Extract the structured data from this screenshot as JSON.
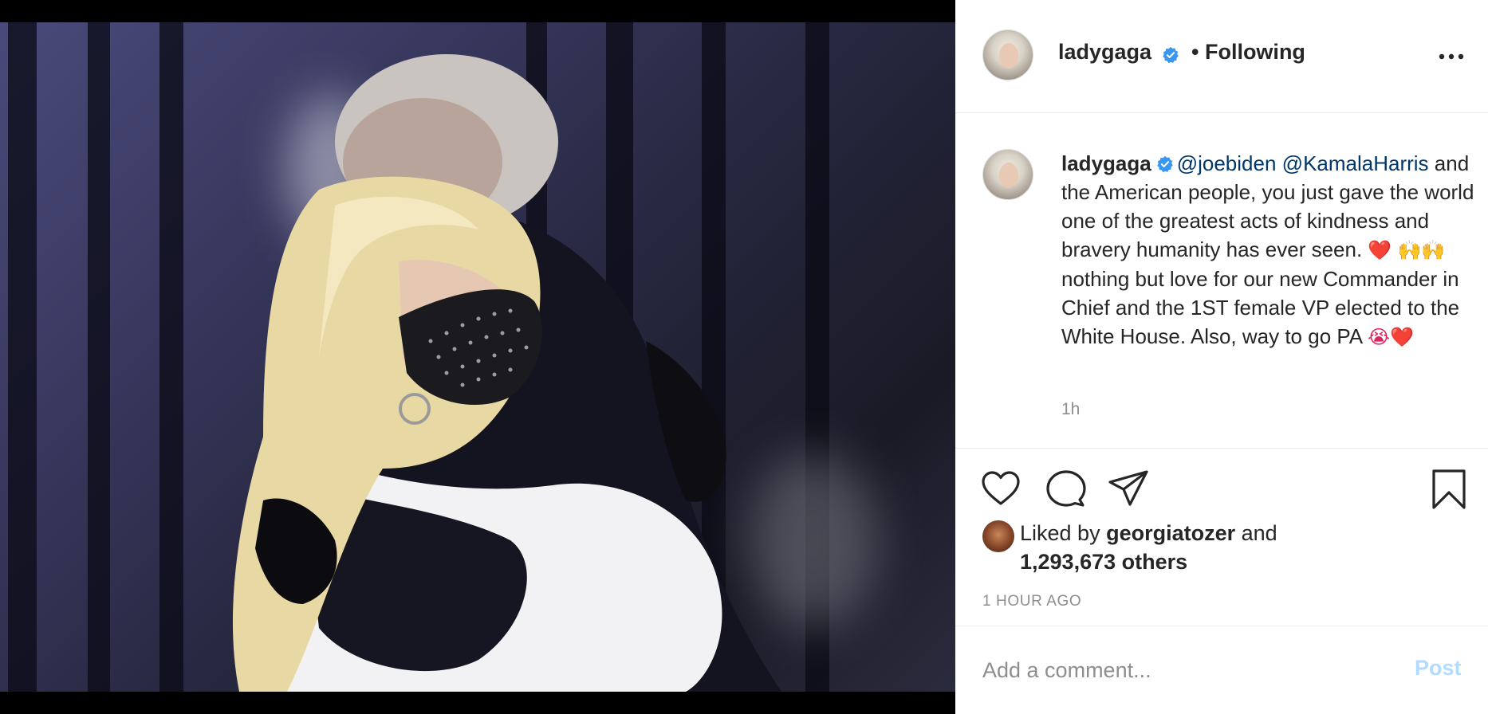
{
  "post": {
    "author": {
      "username": "ladygaga",
      "follow_status": "• Following"
    },
    "more_icon": "more-horizontal-icon",
    "caption": {
      "username": "ladygaga",
      "mention1": "@joebiden",
      "mention2": "@KamalaHarris",
      "text_part1": " and the American people, you just gave the world one of the greatest acts of kindness and bravery humanity has ever seen. ",
      "emoji_heart": "❤️",
      "emoji_hands": "🙌🙌",
      "text_part2": " nothing but love for our new Commander in Chief and the 1ST female VP elected to the White House. Also, way to go PA ",
      "emoji_end": "😭❤️",
      "relative_time": "1h"
    },
    "actions": {
      "like_icon": "heart-icon",
      "comment_icon": "comment-bubble-icon",
      "share_icon": "paper-plane-icon",
      "save_icon": "bookmark-icon"
    },
    "likes": {
      "prefix": "Liked by ",
      "liker": "georgiatozer",
      "connector": " and",
      "others": "1,293,673 others"
    },
    "timestamp": "1 HOUR AGO",
    "comment": {
      "placeholder": "Add a comment...",
      "post_label": "Post"
    }
  },
  "colors": {
    "verified": "#3897f0",
    "mention": "#00376b",
    "post_disabled": "#b3dbff",
    "muted": "#8e8e8e"
  }
}
